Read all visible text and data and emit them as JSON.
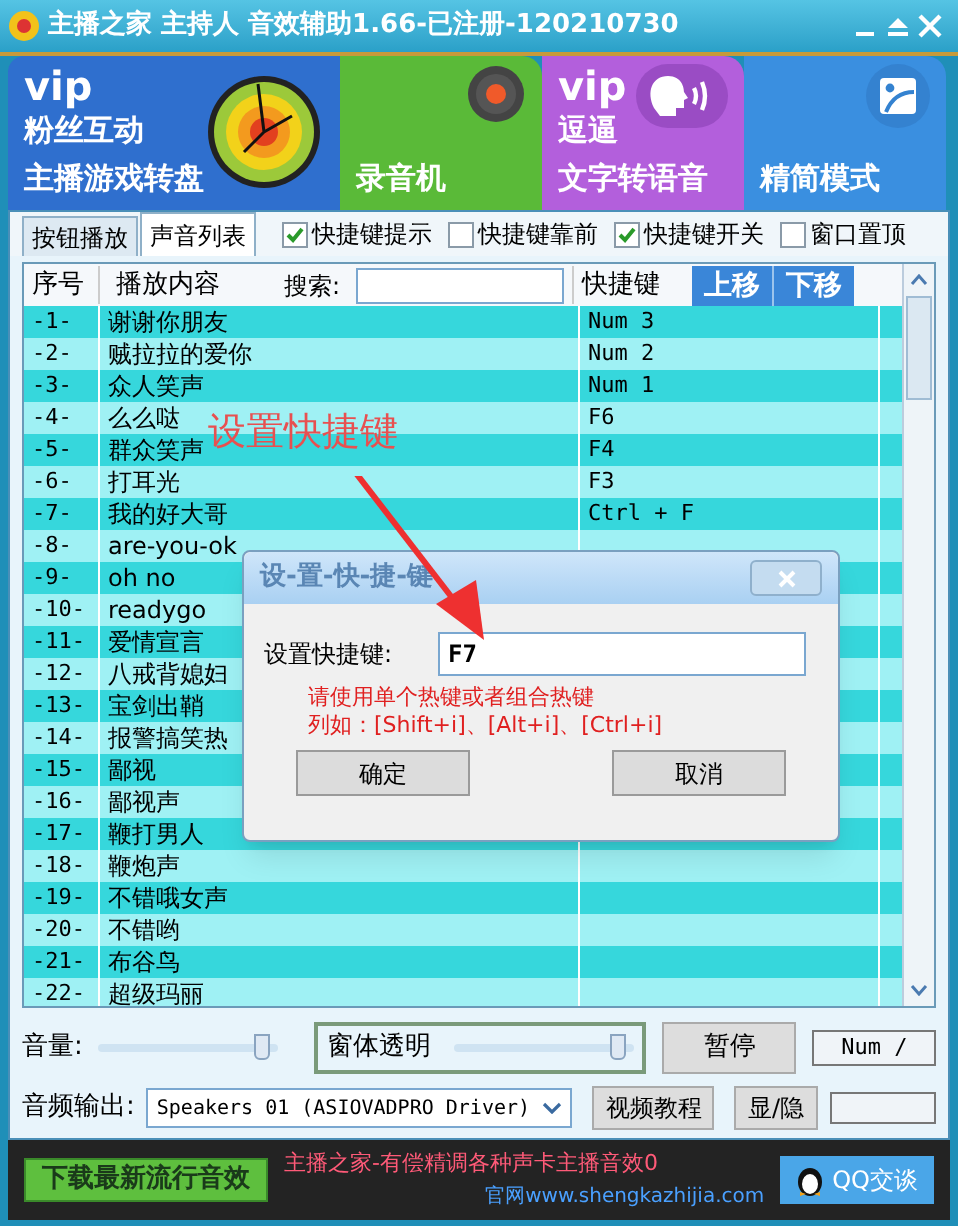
{
  "window": {
    "title": "主播之家 主持人 音效辅助1.66-已注册-120210730"
  },
  "tiles": [
    {
      "kind": "wheel",
      "vip": "vip",
      "lines": [
        "粉丝互动",
        "主播游戏转盘"
      ],
      "color": "#2f6fce"
    },
    {
      "kind": "record",
      "lines": [
        "录音机"
      ],
      "color": "#5aba38"
    },
    {
      "kind": "speech",
      "vip": "vip",
      "lines": [
        "逗逼",
        "文字转语音"
      ],
      "color": "#b35fdc"
    },
    {
      "kind": "frame",
      "lines": [
        "精简模式"
      ],
      "color": "#3a8fe0"
    }
  ],
  "tabs": [
    {
      "label": "按钮播放",
      "selected": false
    },
    {
      "label": "声音列表",
      "selected": true
    }
  ],
  "options": [
    {
      "label": "快捷键提示",
      "checked": true
    },
    {
      "label": "快捷键靠前",
      "checked": false
    },
    {
      "label": "快捷键开关",
      "checked": true
    },
    {
      "label": "窗口置顶",
      "checked": false
    }
  ],
  "table": {
    "columns": [
      "序号",
      "播放内容",
      "快捷键"
    ],
    "search_label": "搜索:",
    "move_buttons": [
      "上移",
      "下移"
    ],
    "rows": [
      {
        "index": "-1-",
        "content": "谢谢你朋友",
        "hotkey": "Num 3"
      },
      {
        "index": "-2-",
        "content": "贼拉拉的爱你",
        "hotkey": "Num 2"
      },
      {
        "index": "-3-",
        "content": "众人笑声",
        "hotkey": "Num 1"
      },
      {
        "index": "-4-",
        "content": "么么哒",
        "hotkey": "F6"
      },
      {
        "index": "-5-",
        "content": "群众笑声",
        "hotkey": "F4"
      },
      {
        "index": "-6-",
        "content": "打耳光",
        "hotkey": "F3"
      },
      {
        "index": "-7-",
        "content": "我的好大哥",
        "hotkey": "Ctrl + F"
      },
      {
        "index": "-8-",
        "content": "are-you-ok"
      },
      {
        "index": "-9-",
        "content": "oh no"
      },
      {
        "index": "-10-",
        "content": "readygo"
      },
      {
        "index": "-11-",
        "content": "爱情宣言"
      },
      {
        "index": "-12-",
        "content": "八戒背媳妇"
      },
      {
        "index": "-13-",
        "content": "宝剑出鞘"
      },
      {
        "index": "-14-",
        "content": "报警搞笑热"
      },
      {
        "index": "-15-",
        "content": "鄙视"
      },
      {
        "index": "-16-",
        "content": "鄙视声"
      },
      {
        "index": "-17-",
        "content": "鞭打男人"
      },
      {
        "index": "-18-",
        "content": "鞭炮声"
      },
      {
        "index": "-19-",
        "content": "不错哦女声"
      },
      {
        "index": "-20-",
        "content": "不错哟"
      },
      {
        "index": "-21-",
        "content": "布谷鸟"
      },
      {
        "index": "-22-",
        "content": "超级玛丽"
      }
    ]
  },
  "controls": {
    "volume": {
      "label": "音量:",
      "level": 0.95
    },
    "transparency": {
      "label": "窗体透明",
      "level": 0.95
    },
    "pause_button": "暂停",
    "hotkey_display": "Num /",
    "output": {
      "label": "音频输出:",
      "value": "Speakers 01 (ASIOVADPRO Driver)"
    },
    "tutorial_button": "视频教程",
    "toggle_button": "显/隐"
  },
  "footer": {
    "download_button": "下载最新流行音效",
    "ad": "主播之家-有偿精调各种声卡主播音效0",
    "website": "官网www.shengkazhijia.com",
    "qq_button": "QQ交谈"
  },
  "annotation": "设置快捷键",
  "dialog": {
    "title": "设-置-快-捷-键",
    "label": "设置快捷键:",
    "value": "F7",
    "hints": [
      "请使用单个热键或者组合热键",
      "列如：[Shift+i]、[Alt+i]、[Ctrl+i]"
    ],
    "ok": "确定",
    "cancel": "取消"
  }
}
